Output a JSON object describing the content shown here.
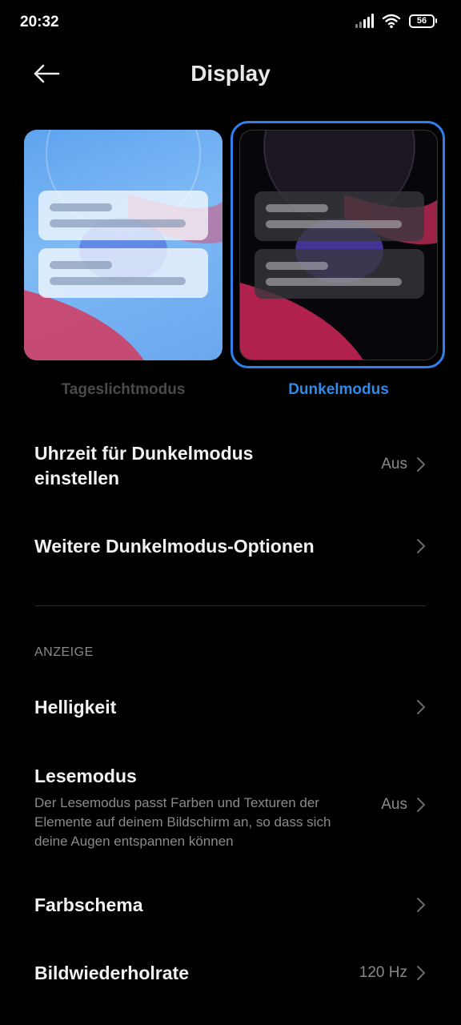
{
  "status": {
    "time": "20:32",
    "battery": "56",
    "icons": [
      "signal-icon",
      "wifi-icon",
      "battery-icon"
    ]
  },
  "header": {
    "title": "Display",
    "back_icon": "arrow-left-icon"
  },
  "modes": {
    "light_label": "Tageslichtmodus",
    "dark_label": "Dunkelmodus",
    "selected": "dark",
    "accent_color": "#2f80ed"
  },
  "settings": {
    "dark_schedule": {
      "title": "Uhrzeit für Dunkelmodus einstellen",
      "value": "Aus"
    },
    "more_dark_options": {
      "title": "Weitere Dunkelmodus-Optionen"
    },
    "section_display": "ANZEIGE",
    "brightness": {
      "title": "Helligkeit"
    },
    "reading_mode": {
      "title": "Lesemodus",
      "description": "Der Lesemodus passt Farben und Texturen der Elemente auf deinem Bildschirm an, so dass sich deine Augen entspannen können",
      "value": "Aus"
    },
    "color_scheme": {
      "title": "Farbschema"
    },
    "refresh_rate": {
      "title": "Bildwiederholrate",
      "value": "120 Hz"
    }
  }
}
